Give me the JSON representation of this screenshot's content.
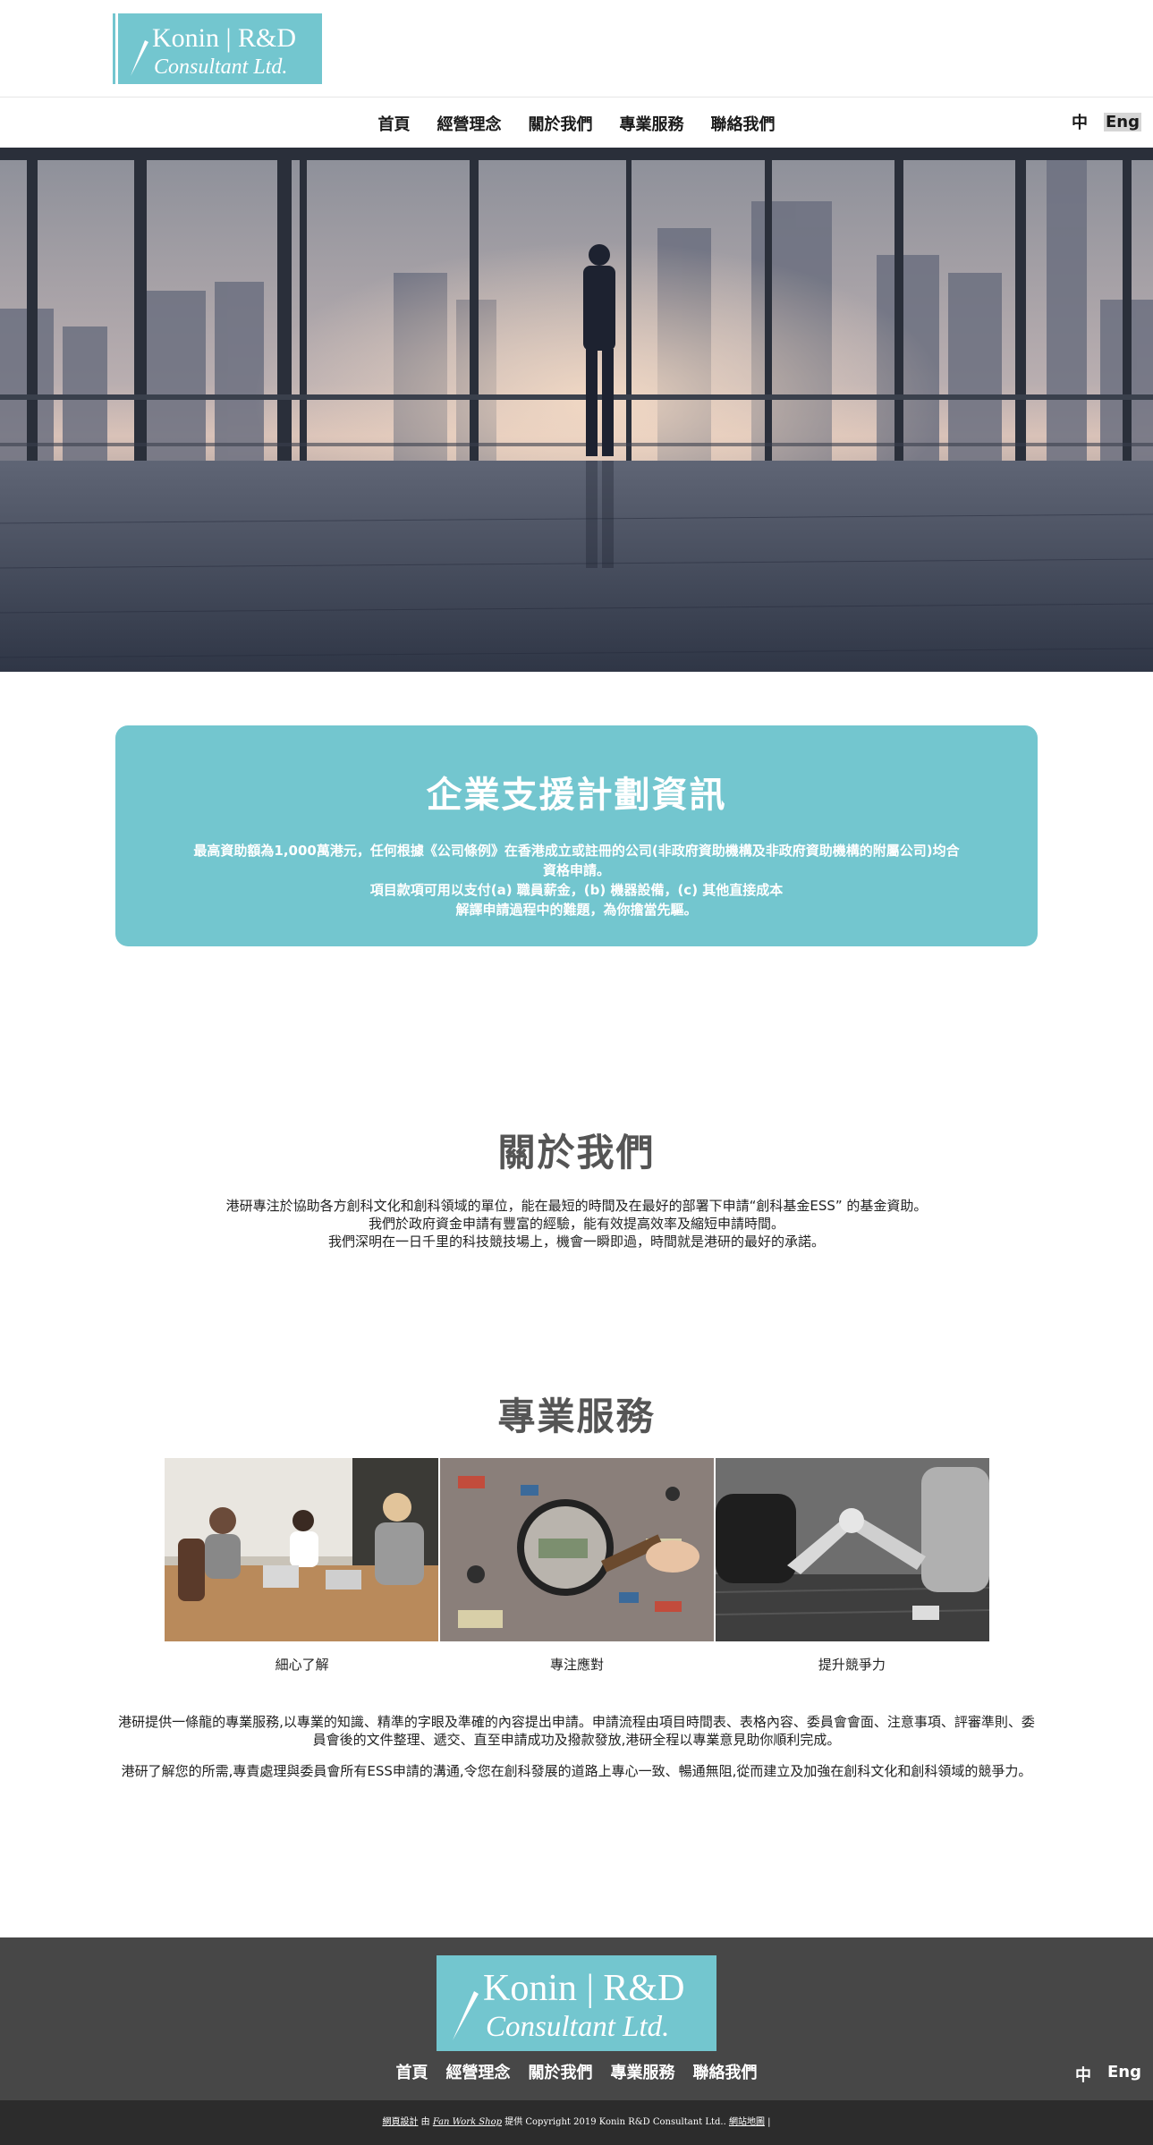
{
  "header": {
    "logo_line1": "Konin | R&D",
    "logo_line2": "Consultant Ltd.",
    "nav": [
      "首頁",
      "經營理念",
      "關於我們",
      "專業服務",
      "聯絡我們"
    ],
    "lang_zh": "中",
    "lang_en": "Eng"
  },
  "hero": {
    "alt_icon": "city-office-photo"
  },
  "card": {
    "title": "企業支援計劃資訊",
    "line1": "最高資助額為1,000萬港元，任何根據《公司條例》在香港成立或註冊的公司(非政府資助機構及非政府資助機構的附屬公司)均合",
    "line2": "資格申請。",
    "line3": "項目款項可用以支付(a) 職員薪金，(b) 機器設備，(c) 其他直接成本",
    "line4": "解譯申請過程中的難題，為你擔當先驅。"
  },
  "about": {
    "title": "關於我們",
    "line1": "港研專注於協助各方創科文化和創科領域的單位，能在最短的時間及在最好的部署下申請“創科基金ESS” 的基金資助。",
    "line2": "我們於政府資金申請有豐富的經驗，能有效提高效率及縮短申請時間。",
    "line3": "我們深明在一日千里的科技競技場上，機會一瞬即過，時間就是港研的最好的承諾。"
  },
  "services": {
    "title": "專業服務",
    "captions": [
      "細心了解",
      "專注應對",
      "提升競爭力"
    ],
    "para1": "港研提供一條龍的專業服務,以專業的知識、精準的字眼及準確的內容提出申請。申請流程由項目時間表、表格內容、委員會會面、注意事項、評審準則、委員會後的文件整理、遞交、直至申請成功及撥款發放,港研全程以專業意見助你順利完成。",
    "para2": "港研了解您的所需,專責處理與委員會所有ESS申請的溝通,令您在創科發展的道路上專心一致、暢通無阻,從而建立及加強在創科文化和創科領域的競爭力。"
  },
  "footer": {
    "nav": [
      "首頁",
      "經營理念",
      "關於我們",
      "專業服務",
      "聯絡我們"
    ],
    "lang_zh": "中",
    "lang_en": "Eng",
    "copy_design": "網頁設計",
    "copy_by": " 由 ",
    "copy_vendor": "Fan Work Shop",
    "copy_rest": " 提供 Copyright 2019 Konin R&D Consultant Ltd.. ",
    "copy_sitemap": "網站地圖",
    "copy_bar": " |"
  },
  "colors": {
    "accent": "#73c6cf",
    "footer_bg": "#474747",
    "copyright_bg": "#2c2c2c"
  }
}
